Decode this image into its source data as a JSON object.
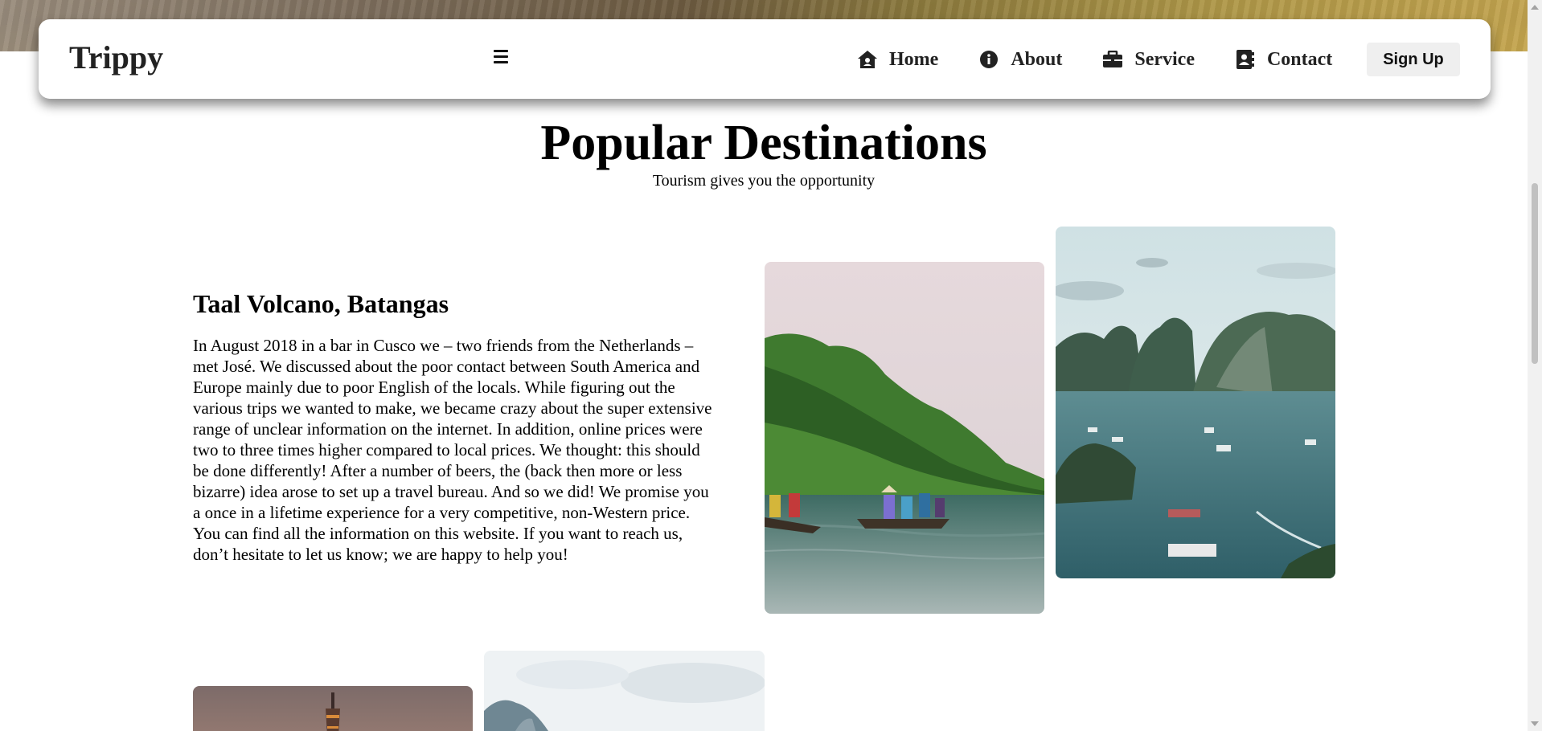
{
  "navbar": {
    "brand": "Trippy",
    "links": [
      {
        "label": "Home",
        "icon": "home-icon"
      },
      {
        "label": "About",
        "icon": "info-icon"
      },
      {
        "label": "Service",
        "icon": "briefcase-icon"
      },
      {
        "label": "Contact",
        "icon": "contact-card-icon"
      }
    ],
    "signup_label": "Sign Up"
  },
  "section": {
    "title": "Popular Destinations",
    "subtitle": "Tourism gives you the opportunity"
  },
  "destination": {
    "heading": "Taal Volcano, Batangas",
    "body": "In August 2018 in a bar in Cusco we – two friends from the Netherlands – met José. We discussed about the poor contact between South America and Europe mainly due to poor English of the locals. While figuring out the various trips we wanted to make, we became crazy about the super extensive range of unclear information on the internet. In addition, online prices were two to three times higher compared to local prices. We thought: this should be done differently! After a number of beers, the (back then more or less bizarre) idea arose to set up a travel bureau. And so we did! We promise you a once in a lifetime experience for a very competitive, non-Western price. You can find all the information on this website. If you want to reach us, don’t hesitate to let us know; we are happy to help you!"
  },
  "colors": {
    "navbar_bg": "#ffffff",
    "signup_bg": "#efefef",
    "text": "#000000"
  }
}
